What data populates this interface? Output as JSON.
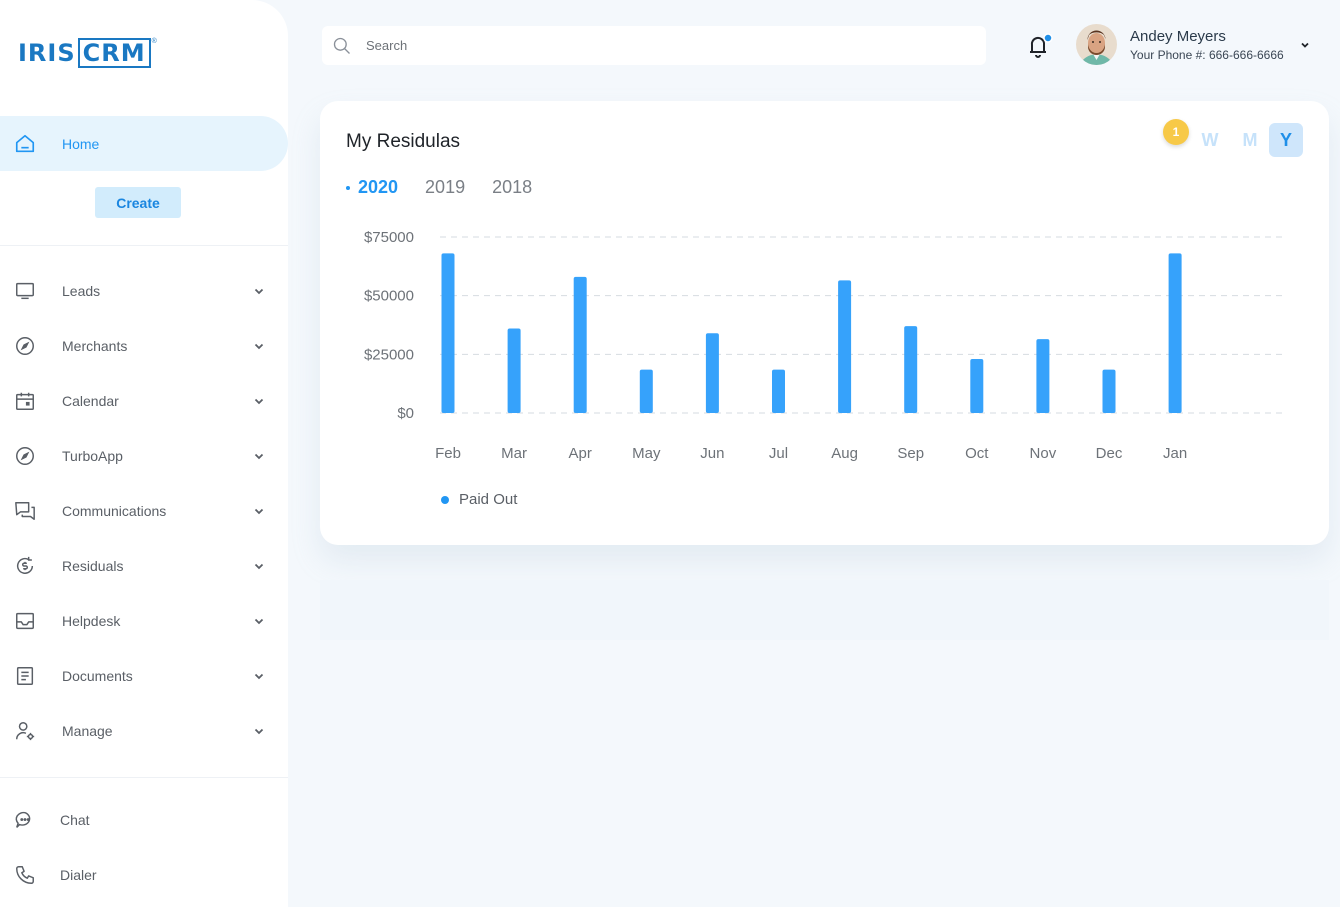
{
  "sidebar": {
    "logo": {
      "part1": "IRIS",
      "part2": "CRM",
      "mark": "®"
    },
    "home": {
      "label": "Home",
      "icon": "home-icon"
    },
    "create_label": "Create",
    "items": [
      {
        "label": "Leads",
        "icon": "monitor-icon"
      },
      {
        "label": "Merchants",
        "icon": "compass-icon"
      },
      {
        "label": "Calendar",
        "icon": "calendar-icon"
      },
      {
        "label": "TurboApp",
        "icon": "compass-icon"
      },
      {
        "label": "Communications",
        "icon": "chat-bubbles-icon"
      },
      {
        "label": "Residuals",
        "icon": "dollar-cycle-icon"
      },
      {
        "label": "Helpdesk",
        "icon": "inbox-icon"
      },
      {
        "label": "Documents",
        "icon": "document-icon"
      },
      {
        "label": "Manage",
        "icon": "user-gear-icon"
      }
    ],
    "footer": [
      {
        "label": "Chat",
        "icon": "chat-icon"
      },
      {
        "label": "Dialer",
        "icon": "phone-icon"
      }
    ]
  },
  "header": {
    "search_placeholder": "Search",
    "notifications_icon": "bell-icon",
    "user": {
      "name": "Andey Meyers",
      "phone": "Your Phone #: 666-666-6666"
    }
  },
  "card": {
    "title": "My Residulas",
    "years": [
      "2020",
      "2019",
      "2018"
    ],
    "active_year": "2020",
    "periods": [
      "W",
      "M",
      "Y"
    ],
    "active_period": "Y",
    "badge": "1"
  },
  "colors": {
    "accent": "#2196f3",
    "bar": "#36a2fb",
    "badge": "#f7c948"
  },
  "chart_data": {
    "type": "bar",
    "categories": [
      "Feb",
      "Mar",
      "Apr",
      "May",
      "Jun",
      "Jul",
      "Aug",
      "Sep",
      "Oct",
      "Nov",
      "Dec",
      "Jan"
    ],
    "series": [
      {
        "name": "Paid Out",
        "values": [
          68000,
          36000,
          58000,
          18500,
          34000,
          18500,
          56500,
          37000,
          23000,
          31500,
          18500,
          68000
        ]
      }
    ],
    "y_ticks": [
      "$0",
      "$25000",
      "$50000",
      "$75000"
    ],
    "ylim": [
      0,
      75000
    ],
    "grid": true,
    "legend": "bottom-left",
    "title": "",
    "xlabel": "",
    "ylabel": ""
  }
}
